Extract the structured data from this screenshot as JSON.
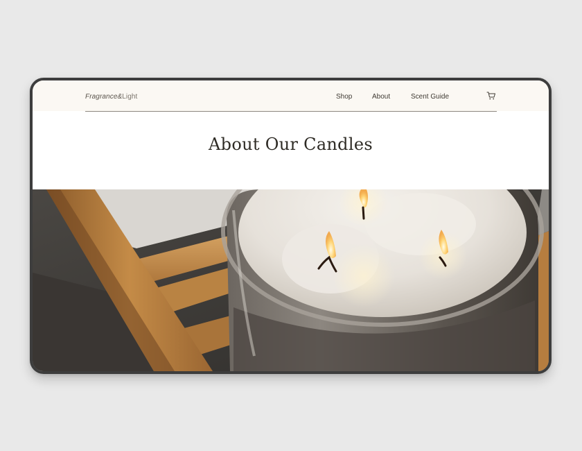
{
  "brand": {
    "name_part1": "Fragrance&",
    "name_part2": "Light"
  },
  "nav": {
    "items": [
      {
        "label": "Shop"
      },
      {
        "label": "About"
      },
      {
        "label": "Scent Guide"
      }
    ],
    "cart_icon": "shopping-cart-icon"
  },
  "hero": {
    "title": "About Our Candles"
  },
  "photo": {
    "subject": "candle-photo"
  },
  "colors": {
    "page_bg": "#e9e9e9",
    "frame": "#3d3d3d",
    "header_bg": "#fbf8f3",
    "title": "#2e2b25"
  }
}
